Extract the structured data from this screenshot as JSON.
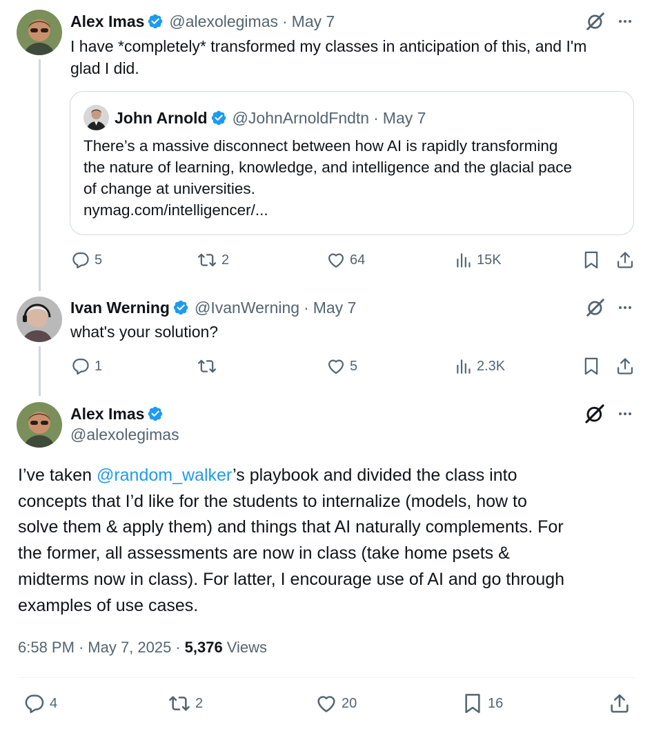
{
  "tweet1": {
    "name": "Alex Imas",
    "handle": "@alexolegimas",
    "date": "May 7",
    "text_line1": "I have *completely* transformed my classes in anticipation of this, and I'm",
    "text_line2": "glad I did.",
    "quote": {
      "name": "John Arnold",
      "handle": "@JohnArnoldFndtn",
      "date": "May 7",
      "line1": "There’s a massive disconnect between how AI is rapidly transforming",
      "line2": "the nature of learning, knowledge, and intelligence and the glacial pace",
      "line3": "of change at universities.",
      "line4": "nymag.com/intelligencer/..."
    },
    "replies": "5",
    "reposts": "2",
    "likes": "64",
    "views": "15K"
  },
  "tweet2": {
    "name": "Ivan Werning",
    "handle": "@IvanWerning",
    "date": "May 7",
    "text": "what's your solution?",
    "replies": "1",
    "likes": "5",
    "views": "2.3K"
  },
  "main": {
    "name": "Alex Imas",
    "handle": "@alexolegimas",
    "text_pre": "I’ve taken ",
    "mention": "@random_walker",
    "text_line1_post": "’s playbook and divided the class into",
    "line2": "concepts that I’d like for the students to internalize (models, how to",
    "line3": "solve them & apply them) and things that AI naturally complements. For",
    "line4": "the former, all assessments are now in class (take home psets &",
    "line5": "midterms now in class). For latter, I encourage use of AI and go through",
    "line6": "examples of use cases.",
    "time": "6:58 PM",
    "full_date": "May 7, 2025",
    "view_count": "5,376",
    "views_label": "Views",
    "replies": "4",
    "reposts": "2",
    "likes": "20",
    "bookmarks": "16"
  },
  "sep": "·",
  "colors": {
    "accent": "#1d9bf0",
    "muted": "#536471",
    "border": "#cfd9de"
  },
  "icons": [
    "verified-badge-icon",
    "grok-icon",
    "more-icon",
    "reply-icon",
    "repost-icon",
    "like-icon",
    "views-icon",
    "bookmark-icon",
    "share-icon"
  ]
}
